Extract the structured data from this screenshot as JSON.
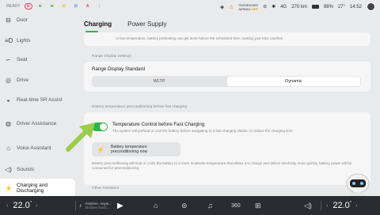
{
  "status": {
    "ready": "READY",
    "pill_colors": [
      "#e8415a",
      "#2fb54d",
      "#2fb54d",
      "#f0b400",
      "#3a8ad8"
    ],
    "passenger_airbag_line1": "PASSENGER",
    "passenger_airbag_line2": "AIRBAG",
    "airbag_state": "OFF",
    "signal": "4G",
    "range": "270 km",
    "battery": "98%",
    "outside_temp": "27°",
    "time": "14:52"
  },
  "sidebar": {
    "items": [
      {
        "label": "Door",
        "icon": "door-icon"
      },
      {
        "label": "Lights",
        "icon": "lights-icon"
      },
      {
        "label": "Seat",
        "icon": "seat-icon"
      },
      {
        "label": "Drive",
        "icon": "drive-icon"
      },
      {
        "label": "Real-time SR Assist",
        "icon": "sr-assist-icon"
      },
      {
        "label": "Driver Assistance",
        "icon": "driver-assistance-icon"
      },
      {
        "label": "Voice Assistant",
        "icon": "voice-assistant-icon"
      },
      {
        "label": "Sounds",
        "icon": "sounds-icon"
      },
      {
        "label": "Charging and Discharging",
        "icon": "charging-icon"
      }
    ]
  },
  "tabs": [
    {
      "label": "Charging",
      "active": true
    },
    {
      "label": "Power Supply",
      "active": false
    }
  ],
  "top_note": "At low temperature, battery preheating can get done before the scheduled time, making your trips carefree",
  "range_display": {
    "section_label": "Range Display Settings",
    "title": "Range Display Standard",
    "options": [
      "WLTP",
      "Dynamic"
    ],
    "selected": "Dynamic"
  },
  "preconditioning": {
    "section_label": "Battery temperature preconditioning before fast charging",
    "toggle_title": "Temperature Control before Fast Charging",
    "toggle_desc": "The system will preheat or cool the battery before navigating to a fast charging station, to reduce the charging time",
    "toggle_on": true,
    "button_line1": "Battery temperature",
    "button_line2": "preconditioning now",
    "note": "Battery preconditioning will heat or cools the battery to a more moderate temperature that allows it to charge and deliver electricity more quickly, battery power will be consumed for preconditioning"
  },
  "other": {
    "section_label": "Other Functions"
  },
  "bottom": {
    "left_temp": "22.0",
    "right_temp": "22.0",
    "deg": "°",
    "music_title": "Anytime, Anyw...",
    "music_artist": "Maidwe Nash..."
  },
  "colors": {
    "accent": "#2fb54d",
    "arrow": "#9acd4a",
    "bottom_bar": "#2a2c31"
  }
}
